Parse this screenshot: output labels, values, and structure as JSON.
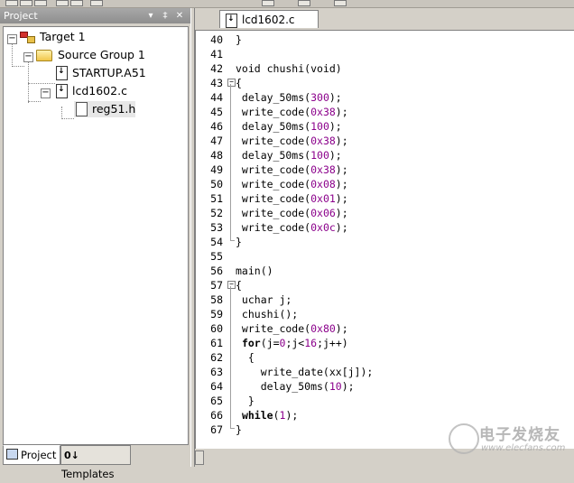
{
  "project_panel": {
    "title": "Project",
    "pin_glyph": "▾",
    "dock_glyph": "‡",
    "close_glyph": "✕",
    "tree": [
      {
        "label": "Target 1",
        "icon": "target-icon"
      },
      {
        "label": "Source Group 1",
        "icon": "folder-icon"
      },
      {
        "label": "STARTUP.A51",
        "icon": "file-icon"
      },
      {
        "label": "lcd1602.c",
        "icon": "file-icon"
      },
      {
        "label": "reg51.h",
        "icon": "header-file-icon"
      }
    ],
    "tabs": [
      {
        "label": "Project",
        "active": true
      },
      {
        "label": "Templates",
        "active": false
      }
    ],
    "templates_prefix": "0↓"
  },
  "editor": {
    "active_tab": "lcd1602.c",
    "lines": [
      {
        "n": "40",
        "parts": [
          {
            "t": "}"
          }
        ]
      },
      {
        "n": "41",
        "parts": []
      },
      {
        "n": "42",
        "parts": [
          {
            "t": "void chushi(void)"
          }
        ]
      },
      {
        "n": "43",
        "parts": [
          {
            "t": "{"
          }
        ],
        "fold": "−"
      },
      {
        "n": "44",
        "parts": [
          {
            "t": " delay_50ms("
          },
          {
            "t": "300",
            "c": "num"
          },
          {
            "t": ");"
          }
        ]
      },
      {
        "n": "45",
        "parts": [
          {
            "t": " write_code("
          },
          {
            "t": "0x38",
            "c": "num"
          },
          {
            "t": ");"
          }
        ]
      },
      {
        "n": "46",
        "parts": [
          {
            "t": " delay_50ms("
          },
          {
            "t": "100",
            "c": "num"
          },
          {
            "t": ");"
          }
        ]
      },
      {
        "n": "47",
        "parts": [
          {
            "t": " write_code("
          },
          {
            "t": "0x38",
            "c": "num"
          },
          {
            "t": ");"
          }
        ]
      },
      {
        "n": "48",
        "parts": [
          {
            "t": " delay_50ms("
          },
          {
            "t": "100",
            "c": "num"
          },
          {
            "t": ");"
          }
        ]
      },
      {
        "n": "49",
        "parts": [
          {
            "t": " write_code("
          },
          {
            "t": "0x38",
            "c": "num"
          },
          {
            "t": ");"
          }
        ]
      },
      {
        "n": "50",
        "parts": [
          {
            "t": " write_code("
          },
          {
            "t": "0x08",
            "c": "num"
          },
          {
            "t": ");"
          }
        ]
      },
      {
        "n": "51",
        "parts": [
          {
            "t": " write_code("
          },
          {
            "t": "0x01",
            "c": "num"
          },
          {
            "t": ");"
          }
        ]
      },
      {
        "n": "52",
        "parts": [
          {
            "t": " write_code("
          },
          {
            "t": "0x06",
            "c": "num"
          },
          {
            "t": ");"
          }
        ]
      },
      {
        "n": "53",
        "parts": [
          {
            "t": " write_code("
          },
          {
            "t": "0x0c",
            "c": "num"
          },
          {
            "t": ");"
          }
        ]
      },
      {
        "n": "54",
        "parts": [
          {
            "t": "}"
          }
        ]
      },
      {
        "n": "55",
        "parts": []
      },
      {
        "n": "56",
        "parts": [
          {
            "t": "main()"
          }
        ]
      },
      {
        "n": "57",
        "parts": [
          {
            "t": "{"
          }
        ],
        "fold": "−"
      },
      {
        "n": "58",
        "parts": [
          {
            "t": " uchar j;"
          }
        ]
      },
      {
        "n": "59",
        "parts": [
          {
            "t": " chushi();"
          }
        ]
      },
      {
        "n": "60",
        "parts": [
          {
            "t": " write_code("
          },
          {
            "t": "0x80",
            "c": "num"
          },
          {
            "t": ");"
          }
        ]
      },
      {
        "n": "61",
        "parts": [
          {
            "t": " "
          },
          {
            "t": "for",
            "c": "kw"
          },
          {
            "t": "(j="
          },
          {
            "t": "0",
            "c": "num"
          },
          {
            "t": ";j<"
          },
          {
            "t": "16",
            "c": "num"
          },
          {
            "t": ";j++)"
          }
        ]
      },
      {
        "n": "62",
        "parts": [
          {
            "t": "  {"
          }
        ]
      },
      {
        "n": "63",
        "parts": [
          {
            "t": "    write_date(xx[j]);"
          }
        ]
      },
      {
        "n": "64",
        "parts": [
          {
            "t": "    delay_50ms("
          },
          {
            "t": "10",
            "c": "num"
          },
          {
            "t": ");"
          }
        ]
      },
      {
        "n": "65",
        "parts": [
          {
            "t": "  }"
          }
        ]
      },
      {
        "n": "66",
        "parts": [
          {
            "t": " "
          },
          {
            "t": "while",
            "c": "kw"
          },
          {
            "t": "("
          },
          {
            "t": "1",
            "c": "num"
          },
          {
            "t": ");"
          }
        ]
      },
      {
        "n": "67",
        "parts": [
          {
            "t": "}"
          }
        ]
      }
    ]
  },
  "watermark": {
    "title": "电子发烧友",
    "url": "www.elecfans.com"
  },
  "colors": {
    "number": "#8b008b",
    "panel": "#d4d0c8",
    "title_bar": "#9a9a9a"
  }
}
